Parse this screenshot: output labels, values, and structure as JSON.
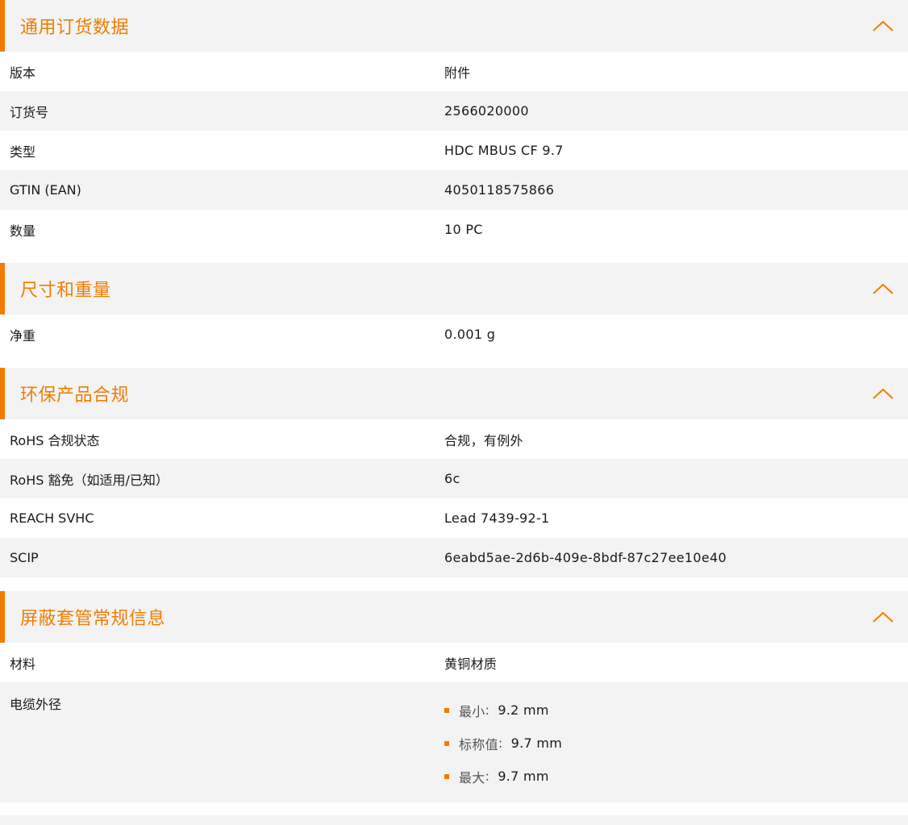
{
  "colors": {
    "accent": "#f07d00",
    "row_alt": "#f3f3f3"
  },
  "sections": [
    {
      "title": "通用订货数据",
      "icon": "chevron-up-icon",
      "rows": [
        {
          "label": "版本",
          "value": "附件"
        },
        {
          "label": "订货号",
          "value": "2566020000"
        },
        {
          "label": "类型",
          "value": "HDC MBUS CF 9.7"
        },
        {
          "label": "GTIN (EAN)",
          "value": "4050118575866"
        },
        {
          "label": "数量",
          "value": "10  PC"
        }
      ]
    },
    {
      "title": "尺寸和重量",
      "icon": "chevron-up-icon",
      "rows": [
        {
          "label": "净重",
          "value": "0.001  g"
        }
      ]
    },
    {
      "title": "环保产品合规",
      "icon": "chevron-up-icon",
      "rows": [
        {
          "label": "RoHS 合规状态",
          "value": "合规，有例外"
        },
        {
          "label": "RoHS 豁免（如适用/已知）",
          "value": "6c"
        },
        {
          "label": "REACH SVHC",
          "value": "Lead 7439-92-1"
        },
        {
          "label": "SCIP",
          "value": "6eabd5ae-2d6b-409e-8bdf-87c27ee10e40"
        }
      ]
    },
    {
      "title": "屏蔽套管常规信息",
      "icon": "chevron-up-icon",
      "rows": [
        {
          "label": "材料",
          "value": "黄铜材质"
        },
        {
          "label": "电缆外径",
          "list": [
            {
              "name": "最小",
              "value": "9.2 mm"
            },
            {
              "name": "标称值",
              "value": "9.7 mm"
            },
            {
              "name": "最大",
              "value": "9.7 mm"
            }
          ]
        }
      ]
    }
  ]
}
